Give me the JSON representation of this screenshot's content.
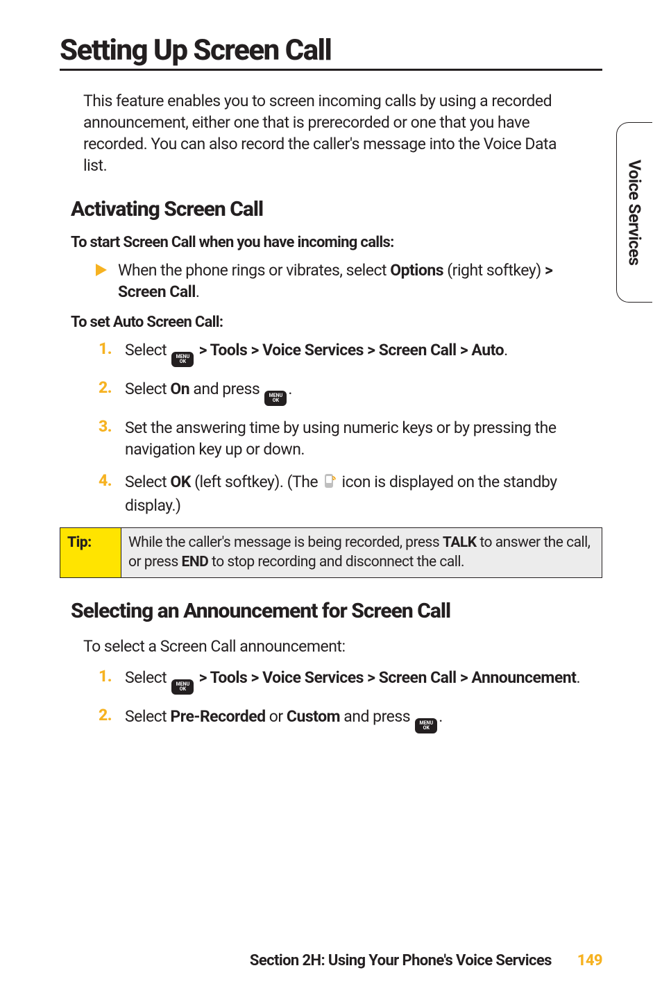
{
  "sideTab": "Voice Services",
  "title": "Setting Up Screen Call",
  "intro": "This feature enables you to screen incoming calls by using a recorded announcement, either one that is prerecorded or one that you have recorded. You can also record the caller's message into the Voice Data list.",
  "section1": {
    "heading": "Activating Screen Call",
    "sub1": "To start Screen Call when you have incoming calls:",
    "bullet_pre": "When the phone rings or vibrates, select ",
    "bullet_options": "Options",
    "bullet_mid": " (right softkey) ",
    "bullet_path": "> Screen Call",
    "bullet_post": ".",
    "sub2": "To set Auto Screen Call:",
    "steps": {
      "s1_pre": "Select ",
      "s1_path": " > Tools > Voice Services > Screen Call > Auto",
      "s1_post": ".",
      "s2_pre": "Select ",
      "s2_on": "On",
      "s2_mid": " and press ",
      "s2_post": ".",
      "s3": "Set the answering time by using numeric keys or by pressing the navigation key up or down.",
      "s4_pre": "Select ",
      "s4_ok": "OK",
      "s4_mid": " (left softkey). (The ",
      "s4_post": " icon is displayed on the standby display.)"
    }
  },
  "menuKey": {
    "top": "MENU",
    "bottom": "OK"
  },
  "tip": {
    "label": "Tip:",
    "body_pre": "While the caller's message is being recorded, press ",
    "body_talk": "TALK",
    "body_mid": " to answer the call, or press ",
    "body_end": "END",
    "body_post": " to stop recording and disconnect the call."
  },
  "section2": {
    "heading": "Selecting an Announcement for Screen Call",
    "lead": "To select a Screen Call announcement:",
    "steps": {
      "s1_pre": "Select ",
      "s1_path": " > Tools > Voice Services > Screen Call > Announcement",
      "s1_post": ".",
      "s2_pre": "Select ",
      "s2_a": "Pre-Recorded",
      "s2_or": " or ",
      "s2_b": "Custom",
      "s2_mid": " and press ",
      "s2_post": "."
    }
  },
  "stepNums": {
    "n1": "1.",
    "n2": "2.",
    "n3": "3.",
    "n4": "4."
  },
  "footer": {
    "section": "Section 2H: Using Your Phone's Voice Services",
    "page": "149"
  }
}
